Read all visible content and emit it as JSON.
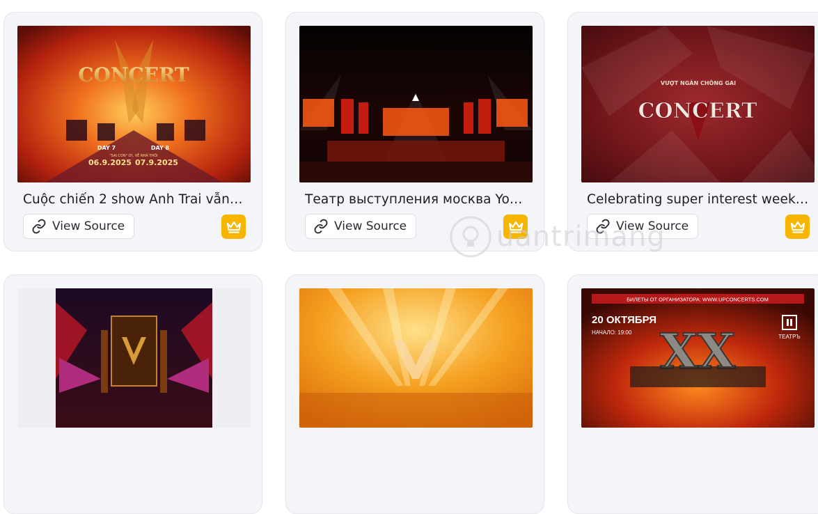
{
  "cards": [
    {
      "title": "Cuộc chiến 2 show Anh Trai vẫn ...",
      "source_label": "View Source",
      "icons": [
        "link-icon",
        "crown-icon"
      ],
      "poster": {
        "logo_text": "CONCERT",
        "day1": "DAY 7",
        "day2": "DAY 8",
        "tagline": "\"SAI CON\" ƠI, VỀ NHÀ THÔI",
        "date1": "06.9.2025",
        "date2": "07.9.2025"
      }
    },
    {
      "title": "Театр выступления москва You...",
      "source_label": "View Source",
      "icons": [
        "link-icon",
        "crown-icon"
      ]
    },
    {
      "title": "Celebrating super interest week ...",
      "source_label": "View Source",
      "icons": [
        "link-icon",
        "crown-icon"
      ],
      "poster": {
        "subtitle": "VƯỢT NGÀN CHÔNG GAI",
        "logo_text": "CONCERT"
      }
    },
    {},
    {},
    {
      "poster": {
        "banner": "БИЛЕТЫ ОТ ОРГАНИЗАТОРА: WWW.UPCONCERTS.COM",
        "date": "20 ОКТЯБРЯ",
        "time": "НАЧАЛО: 19:00",
        "venue": "ТЕАТРЪ",
        "logo": "XX"
      }
    }
  ],
  "watermark": "uantrimang",
  "colors": {
    "crown_bg": "#f7b500",
    "card_bg": "#f4f5f8"
  }
}
